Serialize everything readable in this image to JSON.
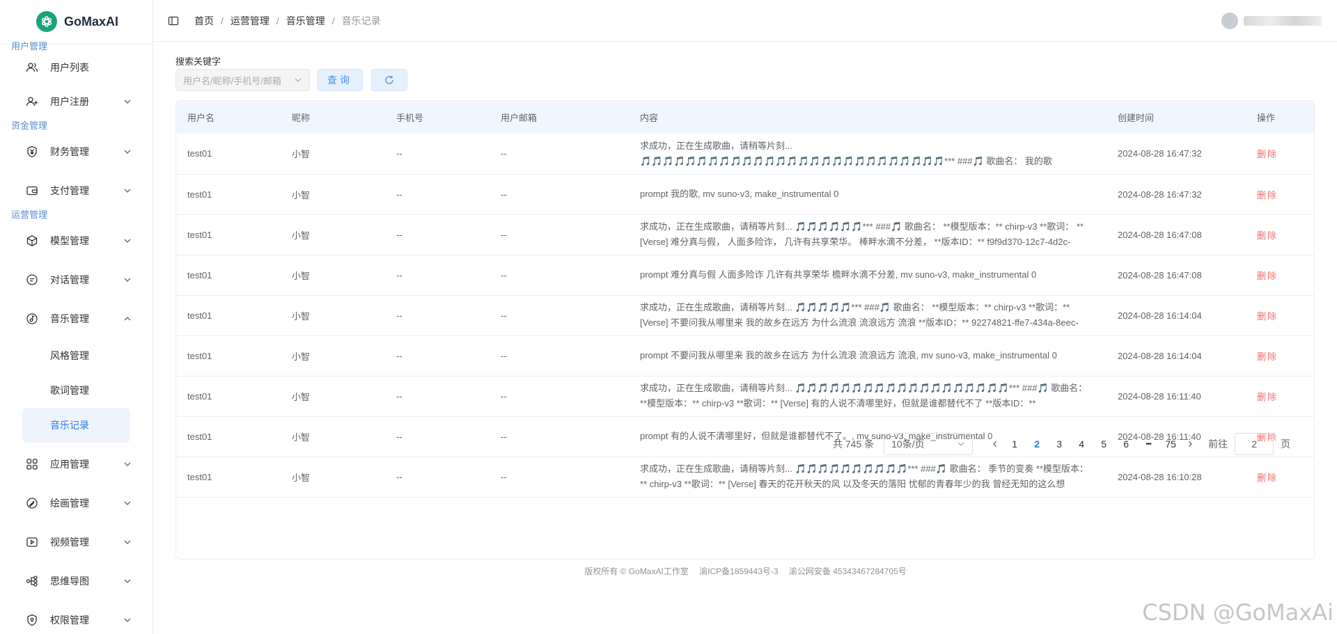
{
  "app": {
    "name": "GoMaxAI"
  },
  "sidebar": {
    "groups": [
      {
        "title": "用户管理"
      },
      {
        "title": "资金管理"
      },
      {
        "title": "运营管理"
      }
    ],
    "items": [
      {
        "label": "用户列表",
        "icon": "users-icon"
      },
      {
        "label": "用户注册",
        "icon": "user-add-icon"
      },
      {
        "label": "财务管理",
        "icon": "yen-icon"
      },
      {
        "label": "支付管理",
        "icon": "wallet-icon"
      },
      {
        "label": "模型管理",
        "icon": "cube-icon"
      },
      {
        "label": "对话管理",
        "icon": "chat-icon"
      },
      {
        "label": "音乐管理",
        "icon": "music-icon"
      },
      {
        "label": "应用管理",
        "icon": "apps-icon"
      },
      {
        "label": "绘画管理",
        "icon": "paint-icon"
      },
      {
        "label": "视频管理",
        "icon": "video-icon"
      },
      {
        "label": "思维导图",
        "icon": "mindmap-icon"
      },
      {
        "label": "权限管理",
        "icon": "shield-icon"
      }
    ],
    "music_sub": [
      {
        "label": "风格管理"
      },
      {
        "label": "歌词管理"
      },
      {
        "label": "音乐记录"
      }
    ]
  },
  "header": {
    "breadcrumb": [
      "首页",
      "运营管理",
      "音乐管理",
      "音乐记录"
    ]
  },
  "search": {
    "label": "搜索关键字",
    "placeholder": "用户名/昵称/手机号/邮箱",
    "query_label": "查询"
  },
  "table": {
    "columns": [
      "用户名",
      "昵称",
      "手机号",
      "用户邮箱",
      "内容",
      "创建时间",
      "操作"
    ],
    "rows": [
      {
        "username": "test01",
        "nickname": "小智",
        "phone": "--",
        "email": "--",
        "content": "求成功，正在生成歌曲，请稍等片刻... 🎵🎵🎵🎵🎵🎵🎵🎵🎵🎵🎵🎵🎵🎵🎵🎵🎵🎵🎵🎵🎵🎵🎵🎵🎵🎵🎵*** ###🎵 歌曲名： 我的歌",
        "time": "2024-08-28 16:47:32",
        "action": "删除"
      },
      {
        "username": "test01",
        "nickname": "小智",
        "phone": "--",
        "email": "--",
        "content": "prompt 我的歌, mv suno-v3, make_instrumental 0",
        "time": "2024-08-28 16:47:32",
        "action": "删除"
      },
      {
        "username": "test01",
        "nickname": "小智",
        "phone": "--",
        "email": "--",
        "content": "求成功，正在生成歌曲，请稍等片刻... 🎵🎵🎵🎵🎵🎵*** ###🎵 歌曲名： **模型版本：** chirp-v3 **歌词： ** [Verse] 难分真与假， 人面多险诈， 几许有共享荣华。 棒畔水滴不分差， **版本ID：** f9f9d370-12c7-4d2c-",
        "time": "2024-08-28 16:47:08",
        "action": "删除"
      },
      {
        "username": "test01",
        "nickname": "小智",
        "phone": "--",
        "email": "--",
        "content": "prompt 难分真与假 人面多险诈 几许有共享荣华 檐畔水滴不分差, mv suno-v3, make_instrumental 0",
        "time": "2024-08-28 16:47:08",
        "action": "删除"
      },
      {
        "username": "test01",
        "nickname": "小智",
        "phone": "--",
        "email": "--",
        "content": "求成功，正在生成歌曲，请稍等片刻... 🎵🎵🎵🎵🎵*** ###🎵 歌曲名： **模型版本：** chirp-v3 **歌词：** [Verse] 不要问我从哪里来 我的故乡在远方 为什么流浪 流浪远方 流浪 **版本ID：** 92274821-ffe7-434a-8eec-",
        "time": "2024-08-28 16:14:04",
        "action": "删除"
      },
      {
        "username": "test01",
        "nickname": "小智",
        "phone": "--",
        "email": "--",
        "content": "prompt 不要问我从哪里来 我的故乡在远方 为什么流浪 流浪远方 流浪, mv suno-v3, make_instrumental 0",
        "time": "2024-08-28 16:14:04",
        "action": "删除"
      },
      {
        "username": "test01",
        "nickname": "小智",
        "phone": "--",
        "email": "--",
        "content": "求成功，正在生成歌曲，请稍等片刻... 🎵🎵🎵🎵🎵🎵🎵🎵🎵🎵🎵🎵🎵🎵🎵🎵🎵🎵🎵*** ###🎵 歌曲名： **模型版本：** chirp-v3 **歌词：** [Verse] 有的人说不清哪里好，但就是谁都替代不了 **版本ID：**",
        "time": "2024-08-28 16:11:40",
        "action": "删除"
      },
      {
        "username": "test01",
        "nickname": "小智",
        "phone": "--",
        "email": "--",
        "content": "prompt 有的人说不清哪里好，但就是谁都替代不了。, mv suno-v3, make_instrumental 0",
        "time": "2024-08-28 16:11:40",
        "action": "删除"
      },
      {
        "username": "test01",
        "nickname": "小智",
        "phone": "--",
        "email": "--",
        "content": "求成功，正在生成歌曲，请稍等片刻... 🎵🎵🎵🎵🎵🎵🎵🎵🎵🎵*** ###🎵 歌曲名： 季节的变奏 **模型版本：** chirp-v3 **歌词：** [Verse] 春天的花开秋天的风 以及冬天的落阳 忧郁的青春年少的我 曾经无知的这么想",
        "time": "2024-08-28 16:10:28",
        "action": "删除"
      }
    ]
  },
  "pagination": {
    "total": "共 745 条",
    "page_size": "10条/页",
    "pages": [
      "1",
      "2",
      "3",
      "4",
      "5",
      "6"
    ],
    "ellipsis": "•••",
    "last_page": "75",
    "current": "2",
    "goto_label": "前往",
    "goto_value": "2",
    "page_suffix": "页"
  },
  "footer": {
    "copyright": "版权所有 © GoMaxAI工作室",
    "icp": "渝ICP备1859443号-3",
    "police": "渝公网安备 45343467284705号"
  },
  "watermark": "CSDN @GoMaxAi",
  "colors": {
    "brand": "#1aa37a",
    "accent": "#2a7bdc",
    "danger": "#f56c6c"
  }
}
